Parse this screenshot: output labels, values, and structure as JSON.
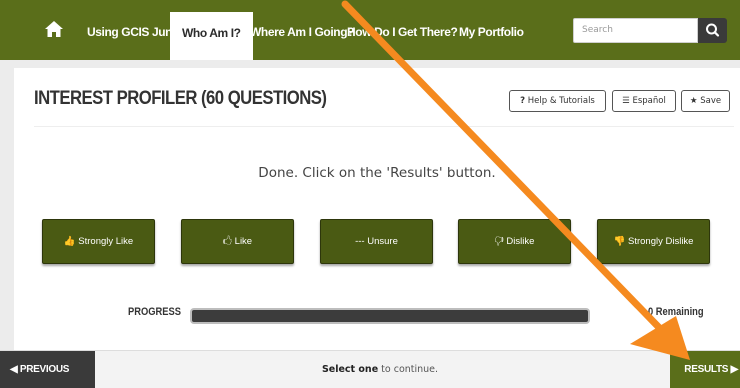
{
  "nav": {
    "items": [
      {
        "label": "Using GCIS Junior"
      },
      {
        "label": "Who Am I?"
      },
      {
        "label": "Where Am I Going?"
      },
      {
        "label": "How Do I Get There?"
      },
      {
        "label": "My Portfolio"
      }
    ],
    "search_placeholder": "Search",
    "accent": "#5a6e1a"
  },
  "page": {
    "title": "INTEREST PROFILER (60 QUESTIONS)",
    "help_label": "Help & Tutorials",
    "help_glyph": "?",
    "lang_label": "Español",
    "lang_glyph": "☰",
    "save_label": "Save",
    "save_glyph": "★",
    "status_message": "Done. Click on the 'Results' button."
  },
  "answers": [
    {
      "label": "Strongly Like",
      "icon": "thumbs-up-solid-icon",
      "glyph": "👍"
    },
    {
      "label": "Like",
      "icon": "thumbs-up-outline-icon",
      "glyph": "🖒"
    },
    {
      "label": "Unsure",
      "icon": "dash-icon",
      "glyph": "---"
    },
    {
      "label": "Dislike",
      "icon": "thumbs-down-outline-icon",
      "glyph": "🖓"
    },
    {
      "label": "Strongly Dislike",
      "icon": "thumbs-down-solid-icon",
      "glyph": "👎"
    }
  ],
  "progress": {
    "label": "PROGRESS",
    "value": 1.0,
    "remaining_label": "0 Remaining"
  },
  "footer": {
    "previous_label": "◀ PREVIOUS",
    "hint_bold": "Select one",
    "hint_rest": " to continue.",
    "results_label": "RESULTS ▶"
  },
  "annotation": {
    "type": "arrow",
    "color": "#f58a1f"
  }
}
